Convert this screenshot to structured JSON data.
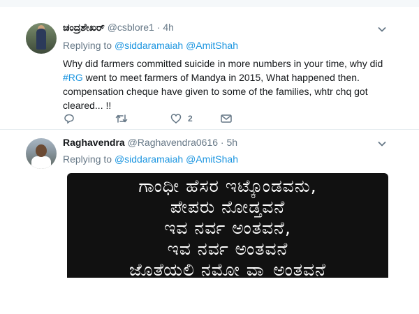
{
  "tweets": [
    {
      "name": "ಚಂದ್ರಶೇಖರ್",
      "handle": "@csblore1",
      "separator": "·",
      "time": "4h",
      "replying_prefix": "Replying to",
      "replying_to": [
        "@siddaramaiah",
        "@AmitShah"
      ],
      "text_before_hashtag": "Why did farmers committed suicide in more numbers in your time, why did ",
      "hashtag": "#RG",
      "text_after_hashtag": " went to meet farmers of Mandya in 2015, What happened then. compensation cheque have given to some of the families, whtr chq got cleared... !!",
      "actions": {
        "reply_count": "",
        "retweet_count": "",
        "like_count": "2"
      }
    },
    {
      "name": "Raghavendra",
      "handle": "@Raghavendra0616",
      "separator": "·",
      "time": "5h",
      "replying_prefix": "Replying to",
      "replying_to": [
        "@siddaramaiah",
        "@AmitShah"
      ],
      "media_lines": [
        "ಗಾಂಧೀ ಹೆಸರ ಇಟ್ಕೊಂಡವನು,",
        "ಪೇಪರು ನೋಡ್ತವನೆ",
        "ಇವ ನರ್ವ ಅಂತವನೆ,",
        "ಇವ ನರ್ವ ಅಂತವನೆ",
        "ಜೊತೆಯಲಿ ನಮೋ ವ್ಹಾ ಅಂತವನೆ"
      ]
    }
  ],
  "icons": {
    "caret": "chevron-down-icon",
    "reply": "reply-icon",
    "retweet": "retweet-icon",
    "like": "heart-icon",
    "dm": "envelope-icon"
  },
  "colors": {
    "link": "#1b95e0",
    "muted": "#657786",
    "text": "#14171a",
    "divider": "#e6ecf0"
  }
}
